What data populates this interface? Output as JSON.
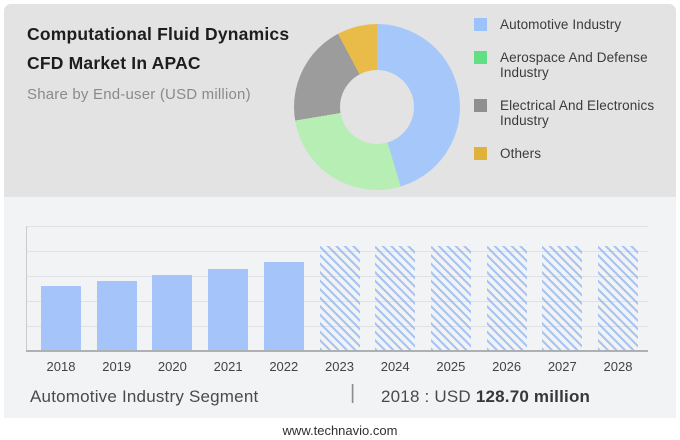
{
  "header": {
    "title_line1": "Computational Fluid Dynamics",
    "title_line2": "CFD Market In APAC",
    "subtitle": "Share by End-user (USD million)"
  },
  "footer": {
    "segment_label": "Automotive Industry Segment",
    "divider": "|",
    "value_prefix": "2018 : USD ",
    "value_bold": "128.70 million"
  },
  "website": "www.technavio.com",
  "colors": {
    "header_bg": "#e3e3e4",
    "chart_panel_bg": "#f2f3f5",
    "bar_blue": "#a5c5fa",
    "hatch_blue": "#8cb2f0",
    "donut_hole": "#e3e3e4"
  },
  "chart_data": [
    {
      "type": "pie",
      "subtype": "donut",
      "title": "Share by End-user (USD million)",
      "labels": [
        "Automotive Industry",
        "Aerospace And Defense Industry",
        "Electrical And Electronics Industry",
        "Others"
      ],
      "values_pct": [
        45.4,
        27.0,
        19.8,
        7.8
      ],
      "slice_colors": [
        "#a6c7fa",
        "#b6eeb3",
        "#9c9c9d",
        "#e9bc4a"
      ],
      "legend_swatch_colors": [
        "#9cc2fb",
        "#62df85",
        "#8e8f90",
        "#e1b23a"
      ],
      "legend_position": "right",
      "data_labels_shown": false,
      "note": "percentages estimated from arc angles; no numeric labels printed on chart"
    },
    {
      "type": "bar",
      "categories": [
        "2018",
        "2019",
        "2020",
        "2021",
        "2022",
        "2023",
        "2024",
        "2025",
        "2026",
        "2027",
        "2028"
      ],
      "values_usd_million": [
        128.7,
        139,
        151,
        163,
        177,
        209,
        209,
        209,
        209,
        209,
        209
      ],
      "hatched_forecast_categories": [
        "2023",
        "2024",
        "2025",
        "2026",
        "2027",
        "2028"
      ],
      "stated_value": {
        "category": "2018",
        "value": 128.7,
        "label": "2018 : USD 128.70 million"
      },
      "bar_color": "#a5c5fa",
      "hatch_pattern": "diagonal-stripes",
      "gridlines": true,
      "y_axis_tick_labels_shown": false,
      "note": "only the 2018 value is printed; 2019-2022 estimated from bar heights, 2023-2028 are equal-height hatched forecast placeholders"
    }
  ]
}
